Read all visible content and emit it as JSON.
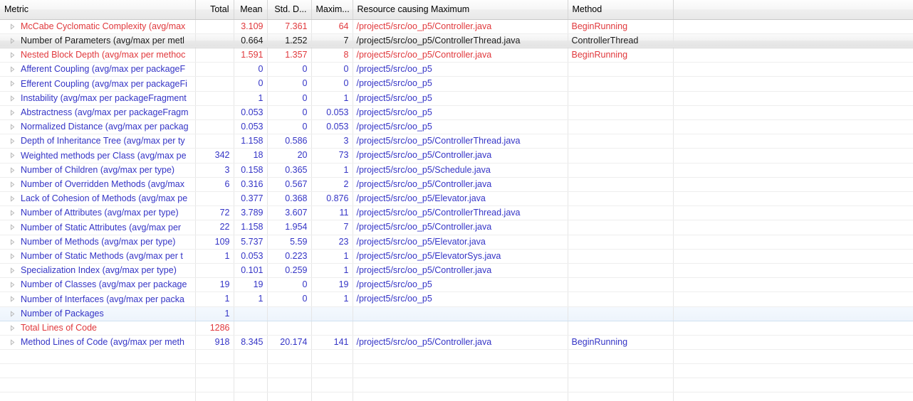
{
  "table": {
    "columns": [
      {
        "key": "metric",
        "label": "Metric",
        "align": "left"
      },
      {
        "key": "total",
        "label": "Total",
        "align": "right"
      },
      {
        "key": "mean",
        "label": "Mean",
        "align": "right"
      },
      {
        "key": "std",
        "label": "Std. D...",
        "align": "right"
      },
      {
        "key": "max",
        "label": "Maxim...",
        "align": "right"
      },
      {
        "key": "resource",
        "label": "Resource causing Maximum",
        "align": "left"
      },
      {
        "key": "method",
        "label": "Method",
        "align": "left"
      },
      {
        "key": "extra",
        "label": "",
        "align": "left"
      }
    ],
    "rows": [
      {
        "metric": "McCabe Cyclomatic Complexity (avg/max",
        "total": "",
        "mean": "3.109",
        "std": "7.361",
        "max": "64",
        "resource": "/project5/src/oo_p5/Controller.java",
        "method": "BeginRunning",
        "extra": "",
        "color": "red",
        "state": "normal"
      },
      {
        "metric": "Number of Parameters (avg/max per metl",
        "total": "",
        "mean": "0.664",
        "std": "1.252",
        "max": "7",
        "resource": "/project5/src/oo_p5/ControllerThread.java",
        "method": "ControllerThread",
        "extra": "",
        "color": "black",
        "state": "hovered"
      },
      {
        "metric": "Nested Block Depth (avg/max per methoc",
        "total": "",
        "mean": "1.591",
        "std": "1.357",
        "max": "8",
        "resource": "/project5/src/oo_p5/Controller.java",
        "method": "BeginRunning",
        "extra": "",
        "color": "red",
        "state": "normal"
      },
      {
        "metric": "Afferent Coupling (avg/max per packageF",
        "total": "",
        "mean": "0",
        "std": "0",
        "max": "0",
        "resource": "/project5/src/oo_p5",
        "method": "",
        "extra": "",
        "color": "blue",
        "state": "normal"
      },
      {
        "metric": "Efferent Coupling (avg/max per packageFi",
        "total": "",
        "mean": "0",
        "std": "0",
        "max": "0",
        "resource": "/project5/src/oo_p5",
        "method": "",
        "extra": "",
        "color": "blue",
        "state": "normal"
      },
      {
        "metric": "Instability (avg/max per packageFragment",
        "total": "",
        "mean": "1",
        "std": "0",
        "max": "1",
        "resource": "/project5/src/oo_p5",
        "method": "",
        "extra": "",
        "color": "blue",
        "state": "normal"
      },
      {
        "metric": "Abstractness (avg/max per packageFragm",
        "total": "",
        "mean": "0.053",
        "std": "0",
        "max": "0.053",
        "resource": "/project5/src/oo_p5",
        "method": "",
        "extra": "",
        "color": "blue",
        "state": "normal"
      },
      {
        "metric": "Normalized Distance (avg/max per packag",
        "total": "",
        "mean": "0.053",
        "std": "0",
        "max": "0.053",
        "resource": "/project5/src/oo_p5",
        "method": "",
        "extra": "",
        "color": "blue",
        "state": "normal"
      },
      {
        "metric": "Depth of Inheritance Tree (avg/max per ty",
        "total": "",
        "mean": "1.158",
        "std": "0.586",
        "max": "3",
        "resource": "/project5/src/oo_p5/ControllerThread.java",
        "method": "",
        "extra": "",
        "color": "blue",
        "state": "normal"
      },
      {
        "metric": "Weighted methods per Class (avg/max pe",
        "total": "342",
        "mean": "18",
        "std": "20",
        "max": "73",
        "resource": "/project5/src/oo_p5/Controller.java",
        "method": "",
        "extra": "",
        "color": "blue",
        "state": "normal"
      },
      {
        "metric": "Number of Children (avg/max per type)",
        "total": "3",
        "mean": "0.158",
        "std": "0.365",
        "max": "1",
        "resource": "/project5/src/oo_p5/Schedule.java",
        "method": "",
        "extra": "",
        "color": "blue",
        "state": "normal"
      },
      {
        "metric": "Number of Overridden Methods (avg/max",
        "total": "6",
        "mean": "0.316",
        "std": "0.567",
        "max": "2",
        "resource": "/project5/src/oo_p5/Controller.java",
        "method": "",
        "extra": "",
        "color": "blue",
        "state": "normal"
      },
      {
        "metric": "Lack of Cohesion of Methods (avg/max pe",
        "total": "",
        "mean": "0.377",
        "std": "0.368",
        "max": "0.876",
        "resource": "/project5/src/oo_p5/Elevator.java",
        "method": "",
        "extra": "",
        "color": "blue",
        "state": "normal"
      },
      {
        "metric": "Number of Attributes (avg/max per type)",
        "total": "72",
        "mean": "3.789",
        "std": "3.607",
        "max": "11",
        "resource": "/project5/src/oo_p5/ControllerThread.java",
        "method": "",
        "extra": "",
        "color": "blue",
        "state": "normal"
      },
      {
        "metric": "Number of Static Attributes (avg/max per",
        "total": "22",
        "mean": "1.158",
        "std": "1.954",
        "max": "7",
        "resource": "/project5/src/oo_p5/Controller.java",
        "method": "",
        "extra": "",
        "color": "blue",
        "state": "normal"
      },
      {
        "metric": "Number of Methods (avg/max per type)",
        "total": "109",
        "mean": "5.737",
        "std": "5.59",
        "max": "23",
        "resource": "/project5/src/oo_p5/Elevator.java",
        "method": "",
        "extra": "",
        "color": "blue",
        "state": "normal"
      },
      {
        "metric": "Number of Static Methods (avg/max per t",
        "total": "1",
        "mean": "0.053",
        "std": "0.223",
        "max": "1",
        "resource": "/project5/src/oo_p5/ElevatorSys.java",
        "method": "",
        "extra": "",
        "color": "blue",
        "state": "normal"
      },
      {
        "metric": "Specialization Index (avg/max per type)",
        "total": "",
        "mean": "0.101",
        "std": "0.259",
        "max": "1",
        "resource": "/project5/src/oo_p5/Controller.java",
        "method": "",
        "extra": "",
        "color": "blue",
        "state": "normal"
      },
      {
        "metric": "Number of Classes (avg/max per package",
        "total": "19",
        "mean": "19",
        "std": "0",
        "max": "19",
        "resource": "/project5/src/oo_p5",
        "method": "",
        "extra": "",
        "color": "blue",
        "state": "normal"
      },
      {
        "metric": "Number of Interfaces (avg/max per packa",
        "total": "1",
        "mean": "1",
        "std": "0",
        "max": "1",
        "resource": "/project5/src/oo_p5",
        "method": "",
        "extra": "",
        "color": "blue",
        "state": "normal"
      },
      {
        "metric": "Number of Packages",
        "total": "1",
        "mean": "",
        "std": "",
        "max": "",
        "resource": "",
        "method": "",
        "extra": "",
        "color": "blue",
        "state": "selected"
      },
      {
        "metric": "Total Lines of Code",
        "total": "1286",
        "mean": "",
        "std": "",
        "max": "",
        "resource": "",
        "method": "",
        "extra": "",
        "color": "red",
        "state": "normal"
      },
      {
        "metric": "Method Lines of Code (avg/max per meth",
        "total": "918",
        "mean": "8.345",
        "std": "20.174",
        "max": "141",
        "resource": "/project5/src/oo_p5/Controller.java",
        "method": "BeginRunning",
        "extra": "",
        "color": "blue",
        "state": "normal"
      },
      {
        "metric": "",
        "total": "",
        "mean": "",
        "std": "",
        "max": "",
        "resource": "",
        "method": "",
        "extra": "",
        "color": "blue",
        "state": "empty"
      },
      {
        "metric": "",
        "total": "",
        "mean": "",
        "std": "",
        "max": "",
        "resource": "",
        "method": "",
        "extra": "",
        "color": "blue",
        "state": "empty"
      },
      {
        "metric": "",
        "total": "",
        "mean": "",
        "std": "",
        "max": "",
        "resource": "",
        "method": "",
        "extra": "",
        "color": "blue",
        "state": "empty"
      },
      {
        "metric": "",
        "total": "",
        "mean": "",
        "std": "",
        "max": "",
        "resource": "",
        "method": "",
        "extra": "",
        "color": "blue",
        "state": "empty"
      }
    ],
    "expander_icon": "expand-triangle-icon"
  },
  "colors": {
    "red": "#e0383c",
    "blue": "#3434c6",
    "black": "#1a1a1a",
    "header_bg": "#eeeeee",
    "selection_bg": "#eff6fd",
    "hover_bg": "#e9e9e9",
    "grid_line": "#e6e6e6"
  }
}
